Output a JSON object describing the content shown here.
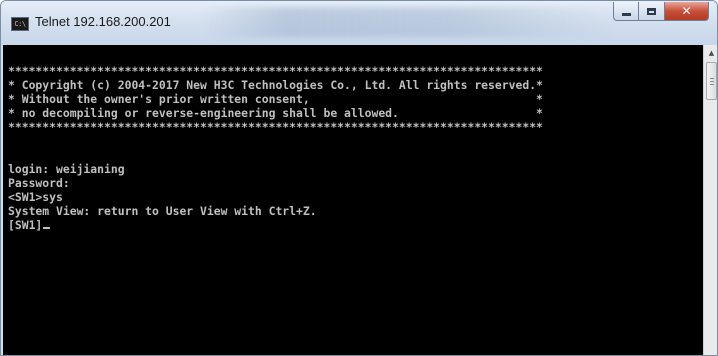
{
  "window": {
    "title": "Telnet 192.168.200.201",
    "icon": "terminal-app-icon",
    "icon_text": "C:\\",
    "controls": {
      "minimize": "minimize-icon",
      "maximize": "maximize-icon",
      "close": "close-icon",
      "close_glyph": "✕"
    }
  },
  "terminal": {
    "lines": [
      "******************************************************************************",
      "* Copyright (c) 2004-2017 New H3C Technologies Co., Ltd. All rights reserved.*",
      "* Without the owner's prior written consent,                                 *",
      "* no decompiling or reverse-engineering shall be allowed.                    *",
      "******************************************************************************",
      "",
      "login: weijianing",
      "Password:",
      "<SW1>sys",
      "System View: return to User View with Ctrl+Z.",
      "[SW1]"
    ]
  },
  "colors": {
    "terminal_bg": "#000000",
    "terminal_text": "#c0c0c0",
    "titlebar": "#d5e1ef",
    "close_button": "#c7503a"
  }
}
